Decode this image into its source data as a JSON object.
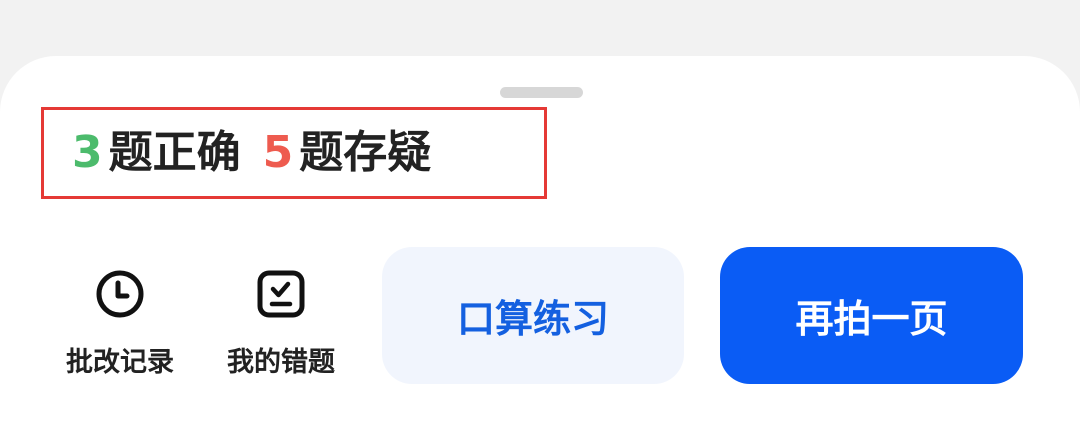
{
  "summary": {
    "correct_count": "3",
    "correct_label": "题正确",
    "doubt_count": "5",
    "doubt_label": "题存疑"
  },
  "tools": {
    "history": {
      "label": "批改记录",
      "icon": "clock-icon"
    },
    "mistakes": {
      "label": "我的错题",
      "icon": "checklist-icon"
    }
  },
  "actions": {
    "practice_label": "口算练习",
    "retake_label": "再拍一页"
  },
  "colors": {
    "correct": "#4cbb6c",
    "doubt": "#ee5b4f",
    "highlight_border": "#e53935",
    "primary": "#0a5cf5",
    "secondary_bg": "#f1f5fd",
    "secondary_text": "#1460e0"
  }
}
